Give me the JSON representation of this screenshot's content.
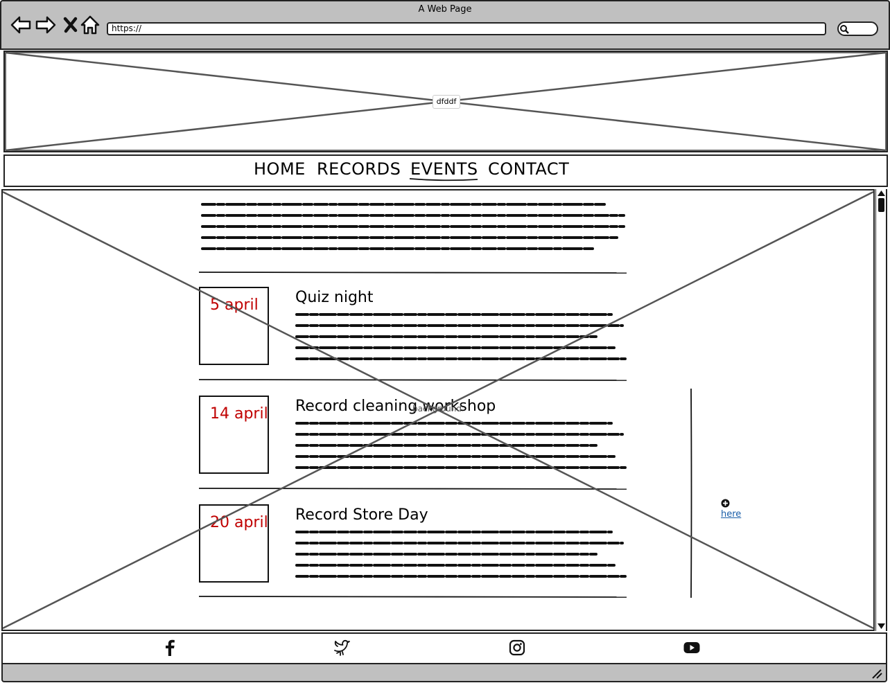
{
  "browser": {
    "title": "A Web Page",
    "url": "https://"
  },
  "header": {
    "image_label": "dfddf"
  },
  "nav": {
    "items": [
      {
        "label": "HOME"
      },
      {
        "label": "RECORDS"
      },
      {
        "label": "EVENTS",
        "active": true
      },
      {
        "label": "CONTACT"
      }
    ]
  },
  "content": {
    "background_label": "background",
    "events": [
      {
        "date": "5 april",
        "title": "Quiz night"
      },
      {
        "date": "14 april",
        "title": "Record cleaning workshop"
      },
      {
        "date": "20 april",
        "title": "Record Store Day"
      }
    ],
    "side_link": "here"
  },
  "footer": {
    "icons": [
      "facebook-icon",
      "twitter-icon",
      "instagram-icon",
      "youtube-icon"
    ]
  },
  "colors": {
    "chrome": "#c0c0c0",
    "date_red": "#c00000",
    "link_blue": "#1a5ea8"
  }
}
